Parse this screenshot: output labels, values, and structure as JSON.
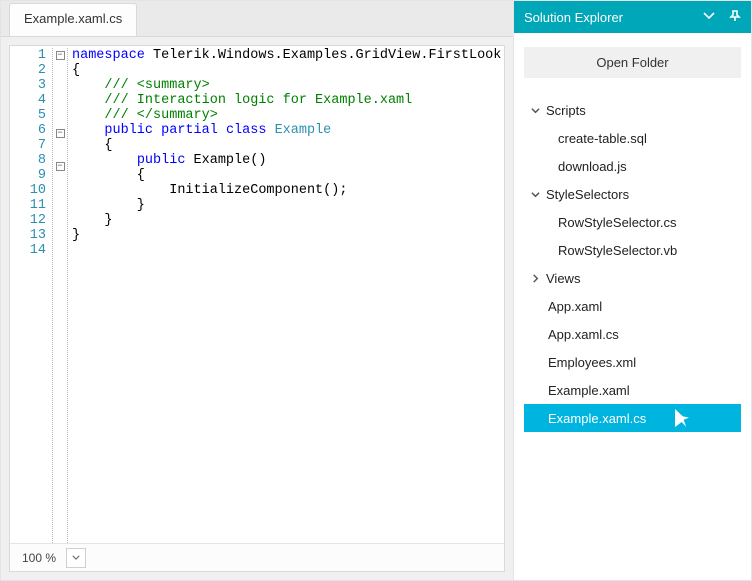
{
  "editor": {
    "tab_label": "Example.xaml.cs",
    "zoom": "100 %",
    "line_numbers": [
      "1",
      "2",
      "3",
      "4",
      "5",
      "6",
      "7",
      "8",
      "9",
      "10",
      "11",
      "12",
      "13",
      "14"
    ],
    "fold_lines": [
      1,
      6,
      8
    ],
    "code": [
      [
        [
          "k",
          "namespace"
        ],
        [
          "p",
          " Telerik.Windows.Examples.GridView.FirstLook"
        ]
      ],
      [
        [
          "p",
          "{"
        ]
      ],
      [
        [
          "p",
          "    "
        ],
        [
          "c",
          "/// <summary>"
        ]
      ],
      [
        [
          "p",
          "    "
        ],
        [
          "c",
          "/// Interaction logic for Example.xaml"
        ]
      ],
      [
        [
          "p",
          "    "
        ],
        [
          "c",
          "/// </summary>"
        ]
      ],
      [
        [
          "p",
          "    "
        ],
        [
          "k",
          "public"
        ],
        [
          "p",
          " "
        ],
        [
          "k",
          "partial"
        ],
        [
          "p",
          " "
        ],
        [
          "k",
          "class"
        ],
        [
          "p",
          " "
        ],
        [
          "t",
          "Example"
        ]
      ],
      [
        [
          "p",
          "    {"
        ]
      ],
      [
        [
          "p",
          "        "
        ],
        [
          "k",
          "public"
        ],
        [
          "p",
          " Example()"
        ]
      ],
      [
        [
          "p",
          "        {"
        ]
      ],
      [
        [
          "p",
          "            InitializeComponent();"
        ]
      ],
      [
        [
          "p",
          "        }"
        ]
      ],
      [
        [
          "p",
          "    }"
        ]
      ],
      [
        [
          "p",
          "}"
        ]
      ],
      [
        [
          "p",
          ""
        ]
      ]
    ]
  },
  "explorer": {
    "title": "Solution Explorer",
    "open_folder_label": "Open Folder",
    "tree": [
      {
        "label": "Scripts",
        "type": "folder",
        "expanded": true
      },
      {
        "label": "create-table.sql",
        "type": "file",
        "parent": 0
      },
      {
        "label": "download.js",
        "type": "file",
        "parent": 0
      },
      {
        "label": "StyleSelectors",
        "type": "folder",
        "expanded": true
      },
      {
        "label": "RowStyleSelector.cs",
        "type": "file",
        "parent": 3
      },
      {
        "label": "RowStyleSelector.vb",
        "type": "file",
        "parent": 3
      },
      {
        "label": "Views",
        "type": "folder",
        "expanded": false
      },
      {
        "label": "App.xaml",
        "type": "file"
      },
      {
        "label": "App.xaml.cs",
        "type": "file"
      },
      {
        "label": "Employees.xml",
        "type": "file"
      },
      {
        "label": "Example.xaml",
        "type": "file"
      },
      {
        "label": "Example.xaml.cs",
        "type": "file",
        "selected": true
      }
    ]
  }
}
